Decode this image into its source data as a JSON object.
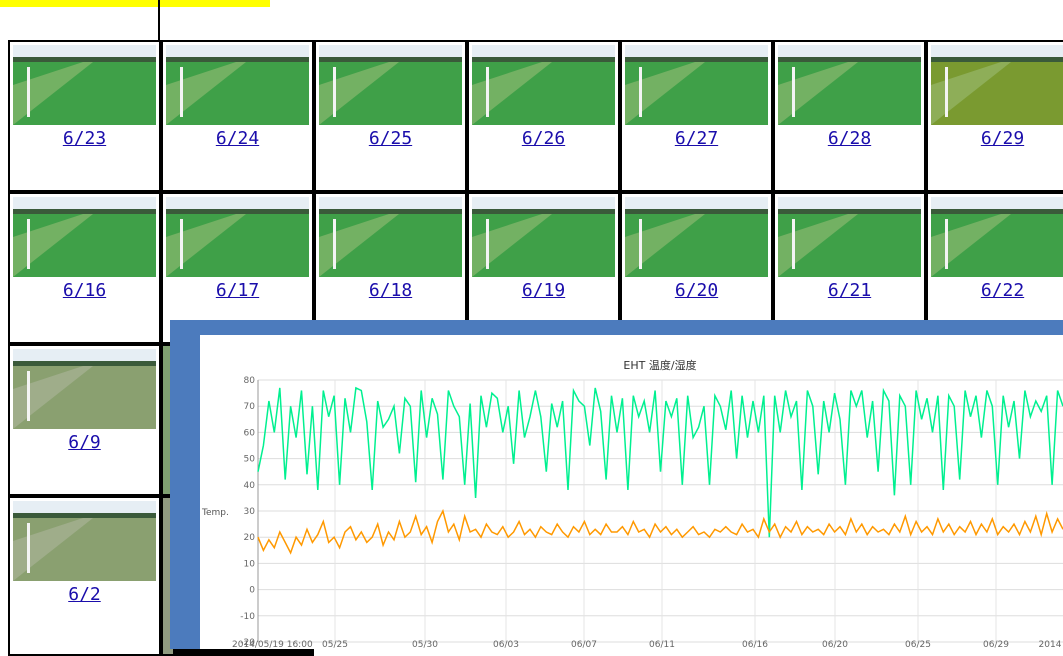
{
  "gallery": {
    "rows": [
      [
        "6/23",
        "6/24",
        "6/25",
        "6/26",
        "6/27",
        "6/28",
        "6/29"
      ],
      [
        "6/16",
        "6/17",
        "6/18",
        "6/19",
        "6/20",
        "6/21",
        "6/22"
      ],
      [
        "6/9"
      ],
      [
        "6/2"
      ]
    ]
  },
  "colors": {
    "link": "#1a0dab",
    "popup_frame": "#4c7bbd",
    "highlight": "#ffff00",
    "humidity": "#00f090",
    "temperature": "#ff9900"
  },
  "chart_data": {
    "type": "line",
    "title": "EHT 温度/湿度",
    "ylabel": "Temp.",
    "ylim": [
      -20,
      80
    ],
    "y_ticks": [
      "80",
      "70",
      "60",
      "50",
      "40",
      "30",
      "20",
      "10",
      "0",
      "-10",
      "-20"
    ],
    "x_ticks": [
      "2014/05/19 16:00",
      "05/25",
      "05/30",
      "06/03",
      "06/07",
      "06/11",
      "06/16",
      "06/20",
      "06/25",
      "06/29",
      "2014"
    ],
    "grid": true,
    "series": [
      {
        "name": "humidity",
        "color": "#00f090",
        "values": [
          45,
          55,
          72,
          60,
          77,
          42,
          70,
          58,
          76,
          44,
          70,
          38,
          76,
          66,
          74,
          40,
          73,
          60,
          77,
          76,
          64,
          38,
          72,
          62,
          65,
          70,
          52,
          73,
          70,
          41,
          76,
          58,
          73,
          67,
          42,
          76,
          70,
          66,
          40,
          71,
          35,
          74,
          62,
          75,
          73,
          60,
          70,
          48,
          76,
          58,
          66,
          76,
          66,
          45,
          71,
          62,
          72,
          38,
          76,
          72,
          70,
          55,
          77,
          68,
          42,
          74,
          60,
          73,
          38,
          74,
          66,
          72,
          60,
          76,
          45,
          72,
          66,
          73,
          40,
          74,
          58,
          62,
          70,
          40,
          74,
          70,
          61,
          76,
          50,
          74,
          58,
          72,
          60,
          74,
          20,
          74,
          60,
          76,
          66,
          72,
          38,
          76,
          70,
          44,
          72,
          60,
          75,
          65,
          40,
          76,
          70,
          76,
          58,
          72,
          45,
          76,
          72,
          36,
          74,
          70,
          40,
          76,
          65,
          73,
          60,
          74,
          38,
          74,
          70,
          42,
          76,
          66,
          74,
          58,
          76,
          70,
          40,
          74,
          62,
          72,
          50,
          76,
          66,
          72,
          68,
          74,
          40,
          76,
          70
        ]
      },
      {
        "name": "temperature",
        "color": "#ff9900",
        "values": [
          20,
          15,
          19,
          16,
          22,
          18,
          14,
          20,
          17,
          23,
          18,
          21,
          26,
          18,
          20,
          16,
          22,
          24,
          19,
          22,
          18,
          20,
          25,
          17,
          22,
          19,
          26,
          20,
          22,
          28,
          21,
          24,
          18,
          26,
          30,
          22,
          25,
          19,
          28,
          22,
          23,
          20,
          25,
          22,
          21,
          24,
          20,
          22,
          26,
          21,
          23,
          20,
          24,
          22,
          21,
          25,
          22,
          20,
          24,
          22,
          26,
          21,
          23,
          21,
          25,
          22,
          22,
          24,
          21,
          26,
          22,
          23,
          20,
          25,
          22,
          24,
          21,
          23,
          20,
          22,
          24,
          21,
          22,
          20,
          23,
          22,
          24,
          22,
          21,
          25,
          22,
          23,
          20,
          27,
          22,
          25,
          20,
          24,
          22,
          26,
          21,
          24,
          22,
          23,
          21,
          25,
          22,
          24,
          21,
          27,
          22,
          25,
          21,
          24,
          22,
          23,
          21,
          25,
          22,
          28,
          21,
          26,
          22,
          24,
          21,
          27,
          22,
          25,
          21,
          24,
          22,
          26,
          21,
          25,
          22,
          27,
          21,
          24,
          22,
          25,
          21,
          26,
          22,
          28,
          21,
          29,
          22,
          27,
          23
        ]
      }
    ]
  }
}
